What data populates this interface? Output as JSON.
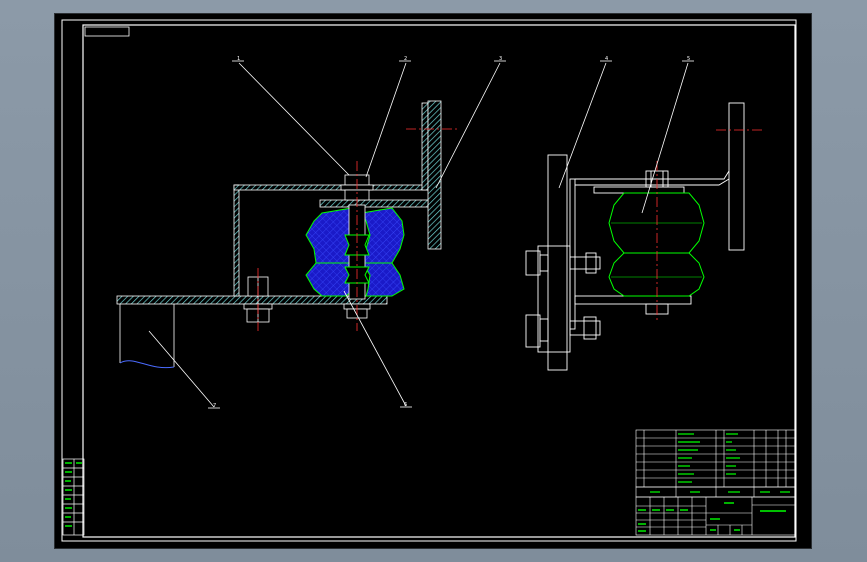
{
  "callouts": {
    "c1": "1",
    "c2": "2",
    "c3": "3",
    "c4": "4",
    "c5": "5",
    "c6": "6",
    "c7": "7"
  },
  "colors": {
    "background": "#000000",
    "frame": "#ffffff",
    "steel_hatch": "#6fd3d3",
    "rubber_fill": "#1a1ac8",
    "rubber_outline": "#00ff00",
    "center_line": "#ff3030",
    "title_text": "#00ff00"
  }
}
